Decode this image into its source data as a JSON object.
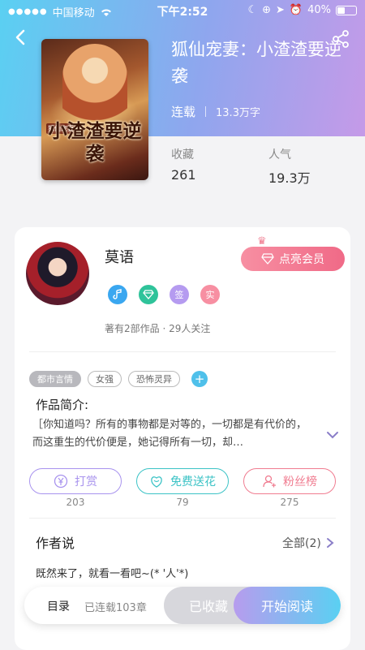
{
  "status_bar": {
    "carrier": "中国移动",
    "time": "下午2:52",
    "battery": "40%"
  },
  "book": {
    "title": "狐仙宠妻：小渣渣要逆袭",
    "cover_text": "小渣渣要逆袭",
    "cover_subtext": "狐仙宠妻",
    "status": "连载",
    "word_count": "13.3万字",
    "stats": [
      {
        "label": "收藏",
        "value": "261"
      },
      {
        "label": "人气",
        "value": "19.3万"
      }
    ]
  },
  "author": {
    "name": "莫语",
    "vip_label": "点亮会员",
    "badges": [
      {
        "icon": "music-note-icon",
        "text": "",
        "color": "#3aa7f0"
      },
      {
        "icon": "gem-icon",
        "text": "",
        "color": "#2fc39a"
      },
      {
        "icon": "sign-badge-icon",
        "text": "签",
        "color": "#b59bf0"
      },
      {
        "icon": "real-name-badge-icon",
        "text": "实",
        "color": "#f78fa2"
      }
    ],
    "works_summary": "著有2部作品 · 29人关注"
  },
  "tags": [
    "都市言情",
    "女强",
    "恐怖灵异"
  ],
  "intro": {
    "title": "作品简介:",
    "text": "［你知道吗？所有的事物都是对等的，一切都是有代价的，而这重生的代价便是，她记得所有一切，却…"
  },
  "actions": [
    {
      "label": "打赏",
      "count": "203",
      "color": "#a893ee",
      "icon": "yen-coin-icon"
    },
    {
      "label": "免费送花",
      "count": "79",
      "color": "#3cc3c6",
      "icon": "flower-icon"
    },
    {
      "label": "粉丝榜",
      "count": "275",
      "color": "#f07c90",
      "icon": "person-icon"
    }
  ],
  "author_says": {
    "title": "作者说",
    "all_label": "全部(2)",
    "message": "既然来了，就看一看吧~(* '人'*)"
  },
  "bottom_bar": {
    "toc_label": "目录",
    "chapters_label": "已连载103章",
    "collected_label": "已收藏",
    "read_label": "开始阅读"
  }
}
